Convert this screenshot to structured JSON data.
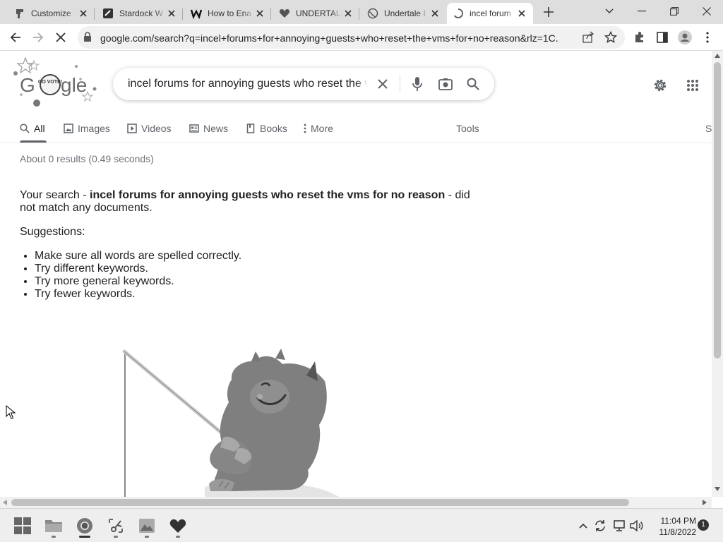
{
  "tabs": [
    {
      "title": "Customize",
      "active": false
    },
    {
      "title": "Stardock W",
      "active": false
    },
    {
      "title": "How to Ena",
      "active": false
    },
    {
      "title": "UNDERTALE",
      "active": false
    },
    {
      "title": "Undertale I",
      "active": false
    },
    {
      "title": "incel forum",
      "active": true
    }
  ],
  "address_bar": {
    "url": "google.com/search?q=incel+forums+for+annoying+guests+who+reset+the+vms+for+no+reason&rlz=1C..."
  },
  "logo_text": "GO VOTE!",
  "search": {
    "query": "incel forums for annoying guests who reset the vms for no reason"
  },
  "nav_tabs": [
    {
      "label": "All",
      "icon": "search-icon",
      "active": true
    },
    {
      "label": "Images",
      "icon": "image-icon",
      "active": false
    },
    {
      "label": "Videos",
      "icon": "play-icon",
      "active": false
    },
    {
      "label": "News",
      "icon": "news-icon",
      "active": false
    },
    {
      "label": "Books",
      "icon": "book-icon",
      "active": false
    },
    {
      "label": "More",
      "icon": "kebab-icon",
      "active": false
    }
  ],
  "tools_label": "Tools",
  "safesearch_label": "S",
  "result_stats": "About 0 results (0.49 seconds)",
  "no_results": {
    "prefix": "Your search - ",
    "query": "incel forums for annoying guests who reset the vms for no reason",
    "suffix": " - did not match any documents."
  },
  "suggestions": {
    "heading": "Suggestions:",
    "items": [
      "Make sure all words are spelled correctly.",
      "Try different keywords.",
      "Try more general keywords.",
      "Try fewer keywords."
    ]
  },
  "taskbar": {
    "apps": [
      "windows-start-icon",
      "file-explorer-icon",
      "chrome-icon",
      "snipping-tool-icon",
      "photos-icon",
      "undertale-heart-icon"
    ],
    "time": "11:04 PM",
    "date": "11/8/2022",
    "notifications": "1"
  },
  "colors": {
    "tabstrip_bg": "#dedede",
    "omnibox_bg": "#f1f1f1",
    "text": "#202124",
    "muted": "#5f6368"
  }
}
